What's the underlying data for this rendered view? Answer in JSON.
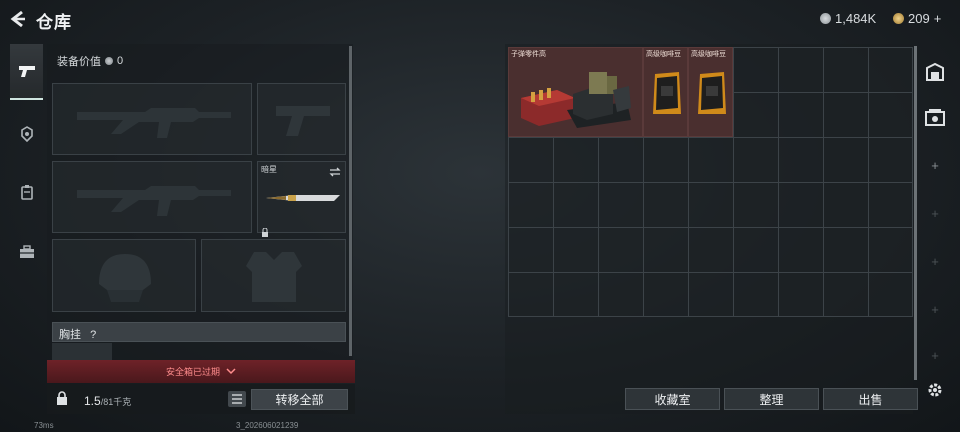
{
  "header": {
    "title": "仓库",
    "currency_silver": "1,484K",
    "currency_gold": "209",
    "gold_plus": "+"
  },
  "nav": {
    "items": [
      {
        "name": "weapons-tab-icon"
      },
      {
        "name": "armor-tab-icon"
      },
      {
        "name": "backpack-tab-icon"
      },
      {
        "name": "case-tab-icon"
      }
    ]
  },
  "equipment": {
    "value_label": "装备价值",
    "value": "0",
    "secondary_slot_label": "暗星",
    "chest_rig_label": "胸挂",
    "chest_rig_help": "?",
    "safe_box_warning": "安全箱已过期"
  },
  "bottom": {
    "weight_value": "1.5",
    "weight_max": "/81千克",
    "transfer_all": "转移全部"
  },
  "storage": {
    "items": [
      {
        "label": "子弹零件高"
      },
      {
        "label": "高级咖啡豆"
      },
      {
        "label": "高级咖啡豆"
      }
    ],
    "buttons": {
      "collection": "收藏室",
      "sort": "整理",
      "sell": "出售"
    },
    "rail_plus": "+"
  },
  "footer": {
    "ping": "73ms",
    "build": "3_202606021239"
  },
  "colors": {
    "accent": "#cfe5e0",
    "warning": "#ff8d8d",
    "warning_bg": "#6e2228",
    "item_bg": "#4a2f2f"
  }
}
